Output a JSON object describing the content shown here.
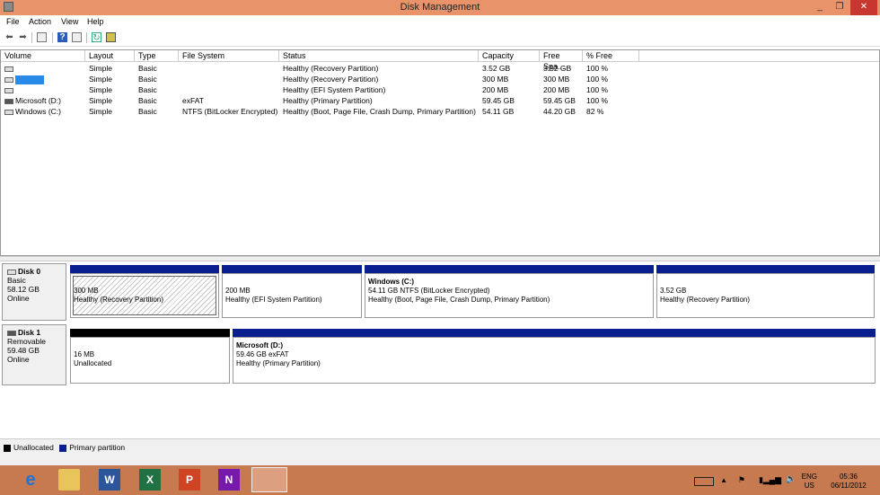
{
  "window": {
    "title": "Disk Management",
    "minimize": "_",
    "maximize": "❐",
    "close": "✕"
  },
  "menu": [
    "File",
    "Action",
    "View",
    "Help"
  ],
  "volume_table": {
    "columns": [
      "Volume",
      "Layout",
      "Type",
      "File System",
      "Status",
      "Capacity",
      "Free Spa...",
      "% Free"
    ],
    "rows": [
      {
        "volume": "",
        "layout": "Simple",
        "type": "Basic",
        "fs": "",
        "status": "Healthy (Recovery Partition)",
        "capacity": "3.52 GB",
        "free": "3.52 GB",
        "pct": "100 %"
      },
      {
        "volume": "",
        "layout": "Simple",
        "type": "Basic",
        "fs": "",
        "status": "Healthy (Recovery Partition)",
        "capacity": "300 MB",
        "free": "300 MB",
        "pct": "100 %"
      },
      {
        "volume": "",
        "layout": "Simple",
        "type": "Basic",
        "fs": "",
        "status": "Healthy (EFI System Partition)",
        "capacity": "200 MB",
        "free": "200 MB",
        "pct": "100 %"
      },
      {
        "volume": "Microsoft (D:)",
        "layout": "Simple",
        "type": "Basic",
        "fs": "exFAT",
        "status": "Healthy (Primary Partition)",
        "capacity": "59.45 GB",
        "free": "59.45 GB",
        "pct": "100 %"
      },
      {
        "volume": "Windows (C:)",
        "layout": "Simple",
        "type": "Basic",
        "fs": "NTFS (BitLocker Encrypted)",
        "status": "Healthy (Boot, Page File, Crash Dump, Primary Partition)",
        "capacity": "54.11 GB",
        "free": "44.20 GB",
        "pct": "82 %"
      }
    ]
  },
  "disks": [
    {
      "name": "Disk 0",
      "type": "Basic",
      "size": "58.12 GB",
      "state": "Online",
      "partitions": [
        {
          "title": "",
          "line1": "300 MB",
          "line2": "Healthy (Recovery Partition)"
        },
        {
          "title": "",
          "line1": "200 MB",
          "line2": "Healthy (EFI System Partition)"
        },
        {
          "title": "Windows  (C:)",
          "line1": "54.11 GB NTFS (BitLocker Encrypted)",
          "line2": "Healthy (Boot, Page File, Crash Dump, Primary Partition)"
        },
        {
          "title": "",
          "line1": "3.52 GB",
          "line2": "Healthy (Recovery Partition)"
        }
      ]
    },
    {
      "name": "Disk 1",
      "type": "Removable",
      "size": "59.48 GB",
      "state": "Online",
      "partitions": [
        {
          "title": "",
          "line1": "16 MB",
          "line2": "Unallocated"
        },
        {
          "title": "Microsoft  (D:)",
          "line1": "59.46 GB exFAT",
          "line2": "Healthy (Primary Partition)"
        }
      ]
    }
  ],
  "legend": {
    "unallocated": "Unallocated",
    "primary": "Primary partition"
  },
  "colors": {
    "primary": "#0a1f8f",
    "unallocated": "#000000",
    "titlebar": "#e9936b",
    "taskbar": "#c77a4f"
  },
  "taskbar": {
    "lang": "ENG",
    "region": "US",
    "time": "05:36",
    "date": "06/11/2012"
  }
}
